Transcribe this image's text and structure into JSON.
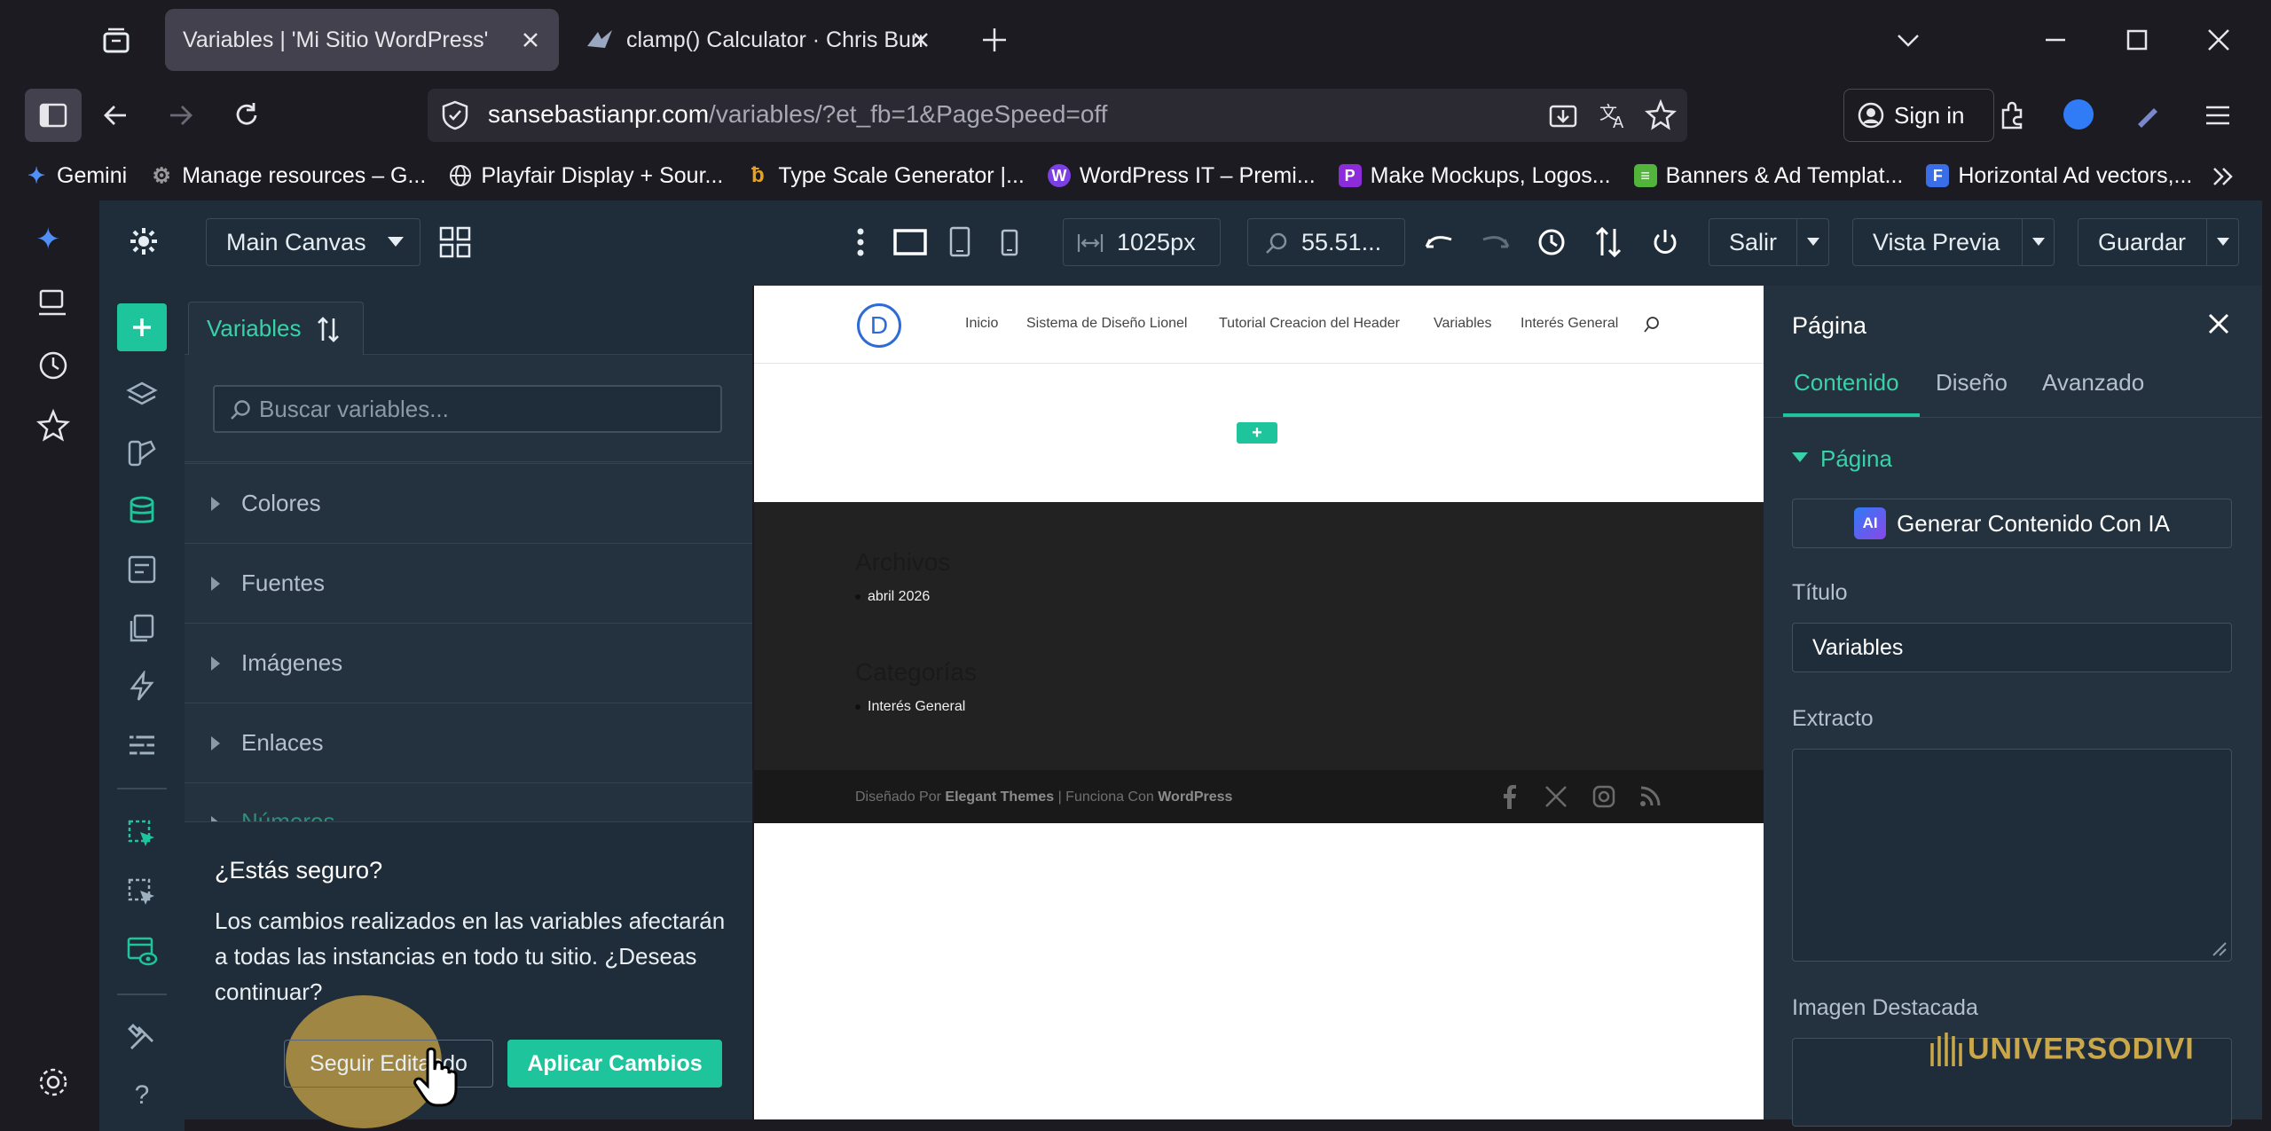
{
  "browser": {
    "tabs": [
      {
        "title": "Variables | 'Mi Sitio WordPress'",
        "active": true
      },
      {
        "title": "clamp() Calculator · Chris Burnell",
        "active": false
      }
    ],
    "url_host": "sansebastianpr.com",
    "url_path": "/variables/?et_fb=1&PageSpeed=off",
    "sign_in_label": "Sign in",
    "bookmarks": [
      {
        "label": "Gemini",
        "icon": "gemini-icon",
        "color": "#4f8ff7"
      },
      {
        "label": "Manage resources – G...",
        "icon": "gear-icon",
        "color": "#8a8a8a"
      },
      {
        "label": "Playfair Display + Sour...",
        "icon": "globe-icon",
        "color": "#8a8a8a"
      },
      {
        "label": "Type Scale Generator |...",
        "icon": "b-icon",
        "color": "#e8a21d"
      },
      {
        "label": "WordPress IT – Premi...",
        "icon": "w-icon",
        "color": "#7b3fe4"
      },
      {
        "label": "Make Mockups, Logos...",
        "icon": "p-icon",
        "color": "#8c2bd9"
      },
      {
        "label": "Banners & Ad Templat...",
        "icon": "banner-icon",
        "color": "#52b43a"
      },
      {
        "label": "Horizontal Ad vectors,...",
        "icon": "f-icon",
        "color": "#3a6ee8"
      }
    ]
  },
  "divi": {
    "canvas_select": "Main Canvas",
    "width_value": "1025px",
    "zoom_value": "55.51...",
    "exit_label": "Salir",
    "preview_label": "Vista Previa",
    "save_label": "Guardar"
  },
  "variables_panel": {
    "tab_label": "Variables",
    "search_placeholder": "Buscar variables...",
    "categories": [
      "Colores",
      "Fuentes",
      "Imágenes",
      "Enlaces",
      "Números"
    ]
  },
  "modal": {
    "title": "¿Estás seguro?",
    "body": "Los cambios realizados en las variables afectarán a todas las instancias en todo tu sitio. ¿Deseas continuar?",
    "keep_label": "Seguir Editando",
    "apply_label": "Aplicar Cambios"
  },
  "site": {
    "logo_letter": "D",
    "nav": [
      "Inicio",
      "Sistema de Diseño Lionel",
      "Tutorial Creacion del Header",
      "Variables",
      "Interés General"
    ],
    "archives_title": "Archivos",
    "archives_item": "abril 2026",
    "categories_title": "Categorías",
    "categories_item": "Interés General",
    "credits_prefix": "Diseñado Por",
    "credits_theme": "Elegant Themes",
    "credits_mid": "| Funciona Con",
    "credits_wp": "WordPress"
  },
  "settings_panel": {
    "title": "Página",
    "tabs": [
      "Contenido",
      "Diseño",
      "Avanzado"
    ],
    "section": "Página",
    "ai_button": "Generar Contenido Con IA",
    "ai_badge": "AI",
    "title_label": "Título",
    "title_value": "Variables",
    "excerpt_label": "Extracto",
    "image_label": "Imagen Destacada"
  },
  "watermark": "UNIVERSODIVI",
  "colors": {
    "accent": "#1ec59c",
    "panel": "#24323f",
    "toolbar": "#1f2d3a"
  }
}
